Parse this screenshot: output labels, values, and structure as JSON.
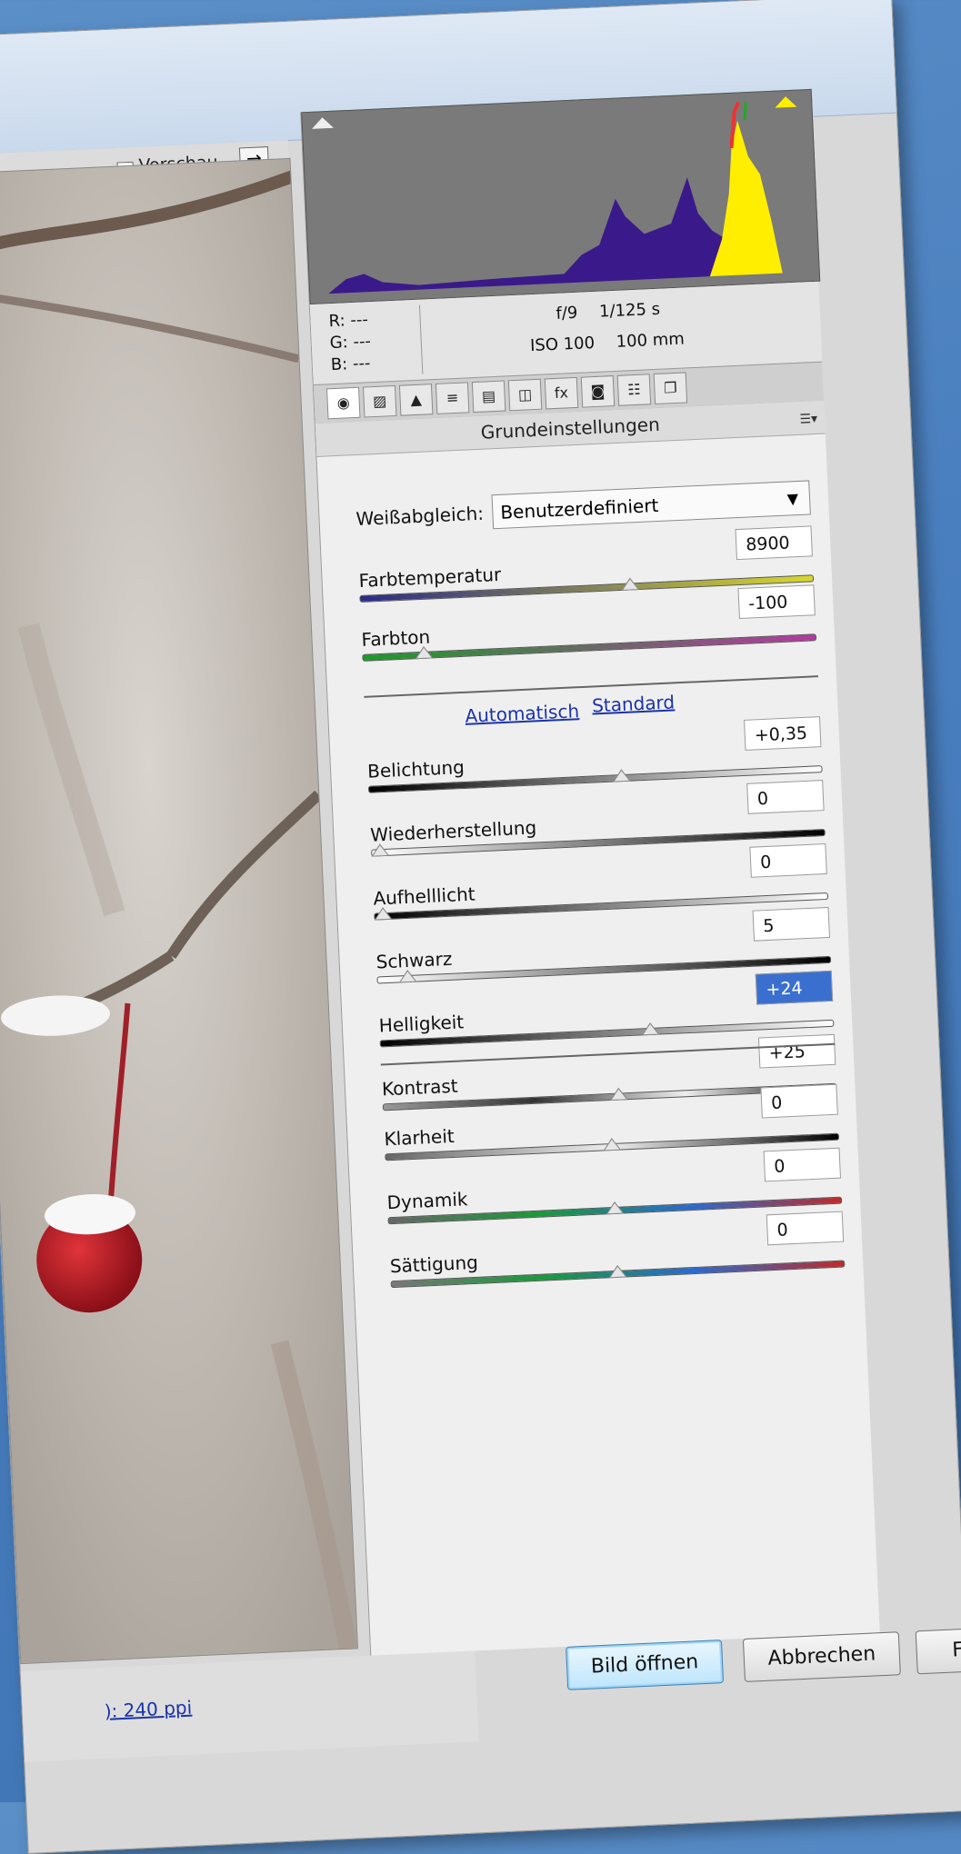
{
  "preview": {
    "vorschau_label": "Vorschau",
    "vorschau_checked": true,
    "swap_glyph": "⇄",
    "status_link": "): 240 ppi"
  },
  "exif": {
    "r": "R:  ---",
    "g": "G:  ---",
    "b": "B:  ---",
    "aperture": "f/9",
    "shutter": "1/125 s",
    "iso": "ISO 100",
    "focal": "100 mm"
  },
  "tabs": [
    {
      "icon": "aperture-icon",
      "glyph": "◉"
    },
    {
      "icon": "tone-curve-icon",
      "glyph": "▨"
    },
    {
      "icon": "detail-icon",
      "glyph": "▲"
    },
    {
      "icon": "hsl-icon",
      "glyph": "≡"
    },
    {
      "icon": "split-toning-icon",
      "glyph": "▤"
    },
    {
      "icon": "lens-correction-icon",
      "glyph": "◫"
    },
    {
      "icon": "fx-icon",
      "glyph": "fx"
    },
    {
      "icon": "camera-calibration-icon",
      "glyph": "◙"
    },
    {
      "icon": "presets-icon",
      "glyph": "☷"
    },
    {
      "icon": "snapshots-icon",
      "glyph": "❐"
    }
  ],
  "section_title": "Grundeinstellungen",
  "white_balance": {
    "label": "Weißabgleich:",
    "value": "Benutzerdefiniert"
  },
  "sliders": [
    {
      "key": "farbtemperatur",
      "label": "Farbtemperatur",
      "value": "8900",
      "level": 0.6,
      "track": "linear-gradient(90deg,#2a2a8a,#d8d82a)"
    },
    {
      "key": "farbton",
      "label": "Farbton",
      "value": "-100",
      "level": 0.12,
      "track": "linear-gradient(90deg,#1d9a2a,#b33aa0)"
    },
    {
      "key": "belichtung",
      "label": "Belichtung",
      "value": "+0,35",
      "level": 0.56,
      "track": "linear-gradient(90deg,#000,#fff)"
    },
    {
      "key": "wiederherstellung",
      "label": "Wiederherstellung",
      "value": "0",
      "level": 0.0,
      "track": "linear-gradient(90deg,#fff,#000)"
    },
    {
      "key": "aufhelllicht",
      "label": "Aufhelllicht",
      "value": "0",
      "level": 0.0,
      "track": "linear-gradient(90deg,#000,#fff)"
    },
    {
      "key": "schwarz",
      "label": "Schwarz",
      "value": "5",
      "level": 0.05,
      "track": "linear-gradient(90deg,#fff,#000)"
    },
    {
      "key": "helligkeit",
      "label": "Helligkeit",
      "value": "+24",
      "level": 0.6,
      "track": "linear-gradient(90deg,#000,#fff)",
      "selected": true
    },
    {
      "key": "kontrast",
      "label": "Kontrast",
      "value": "+25",
      "level": 0.52,
      "track": "linear-gradient(90deg,#999,#333,#eee,#000)"
    },
    {
      "key": "klarheit",
      "label": "Klarheit",
      "value": "0",
      "level": 0.5,
      "track": "linear-gradient(90deg,#666,#eee,#000)"
    },
    {
      "key": "dynamik",
      "label": "Dynamik",
      "value": "0",
      "level": 0.5,
      "track": "linear-gradient(90deg,#666,#1a9a3a,#2a6ad0,#c02a2a)"
    },
    {
      "key": "saettigung",
      "label": "Sättigung",
      "value": "0",
      "level": 0.5,
      "track": "linear-gradient(90deg,#777,#1a9a3a,#2a6ad0,#c02a2a)"
    }
  ],
  "links": {
    "auto": "Automatisch",
    "standard": "Standard"
  },
  "buttons": {
    "open": "Bild öffnen",
    "cancel": "Abbrechen",
    "done": "Fertig"
  },
  "colors": {
    "accent": "#3a6fd0",
    "link": "#1a33a8",
    "histogram_blue": "#3a1a8a",
    "histogram_yellow": "#ffee00"
  }
}
